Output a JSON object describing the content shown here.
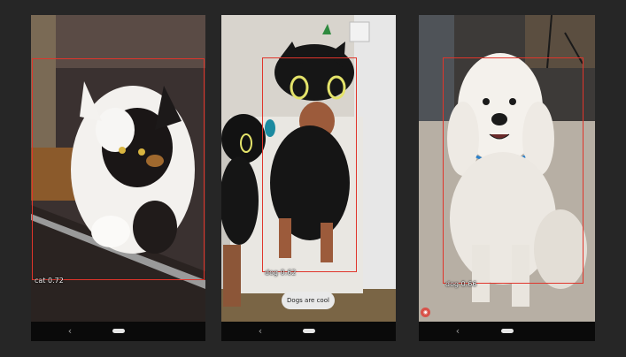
{
  "nav": {
    "back_icon": "‹"
  },
  "phones": [
    {
      "detection": {
        "label": "cat 0.72",
        "class": "cat",
        "score": 0.72
      }
    },
    {
      "detection": {
        "label": "dog 0.62",
        "class": "dog",
        "score": 0.62
      },
      "toast": "Dogs are cool"
    },
    {
      "detection": {
        "label": "dog 0.66",
        "class": "dog",
        "score": 0.66
      }
    }
  ],
  "colors": {
    "background": "#262626",
    "bbox": "#e0352b",
    "toast_bg": "#e9e9e9"
  },
  "icons": [
    "back-icon",
    "home-pill-icon",
    "app-badge-icon"
  ]
}
